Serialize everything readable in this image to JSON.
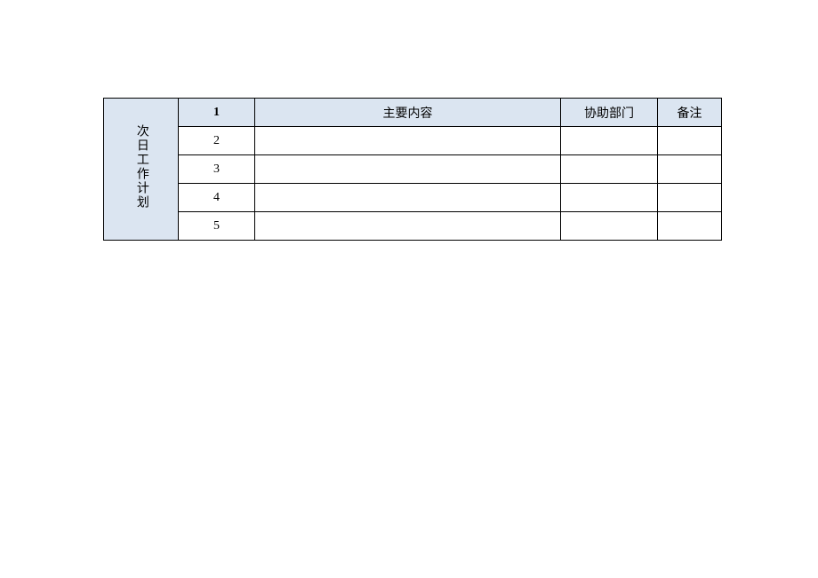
{
  "table": {
    "sideLabel": "次日工作计划",
    "header": {
      "num": "1",
      "content": "主要内容",
      "dept": "协助部门",
      "remark": "备注"
    },
    "rows": [
      {
        "num": "2",
        "content": "",
        "dept": "",
        "remark": ""
      },
      {
        "num": "3",
        "content": "",
        "dept": "",
        "remark": ""
      },
      {
        "num": "4",
        "content": "",
        "dept": "",
        "remark": ""
      },
      {
        "num": "5",
        "content": "",
        "dept": "",
        "remark": ""
      }
    ]
  }
}
